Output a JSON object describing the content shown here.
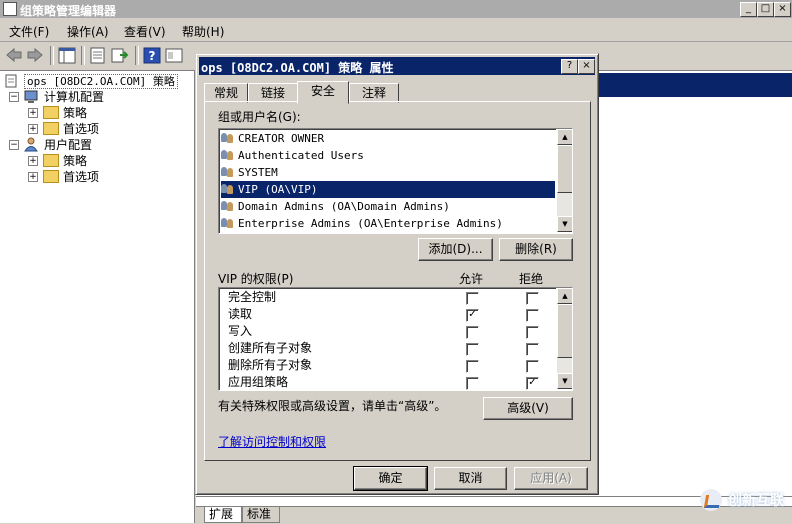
{
  "window": {
    "title": "组策略管理编辑器"
  },
  "menu": [
    "文件(F)",
    "操作(A)",
    "查看(V)",
    "帮助(H)"
  ],
  "tree": {
    "root": "ops [O8DC2.OA.COM] 策略",
    "computer_config": "计算机配置",
    "user_config": "用户配置",
    "policies": "策略",
    "preferences": "首选项"
  },
  "bottom_tabs": [
    "扩展",
    "标准"
  ],
  "dialog": {
    "title": "ops [O8DC2.OA.COM] 策略 属性",
    "tabs": [
      "常规",
      "链接",
      "安全",
      "注释"
    ],
    "active_tab": "安全",
    "groups_label": "组或用户名(G):",
    "users": [
      "CREATOR OWNER",
      "Authenticated Users",
      "SYSTEM",
      "VIP (OA\\VIP)",
      "Domain Admins (OA\\Domain Admins)",
      "Enterprise Admins (OA\\Enterprise Admins)"
    ],
    "selected_user_index": 3,
    "add_button": "添加(D)...",
    "remove_button": "删除(R)",
    "perm_label": "VIP 的权限(P)",
    "allow_header": "允许",
    "deny_header": "拒绝",
    "permissions": [
      {
        "name": "完全控制",
        "allow": false,
        "deny": false
      },
      {
        "name": "读取",
        "allow": true,
        "deny": false
      },
      {
        "name": "写入",
        "allow": false,
        "deny": false
      },
      {
        "name": "创建所有子对象",
        "allow": false,
        "deny": false
      },
      {
        "name": "删除所有子对象",
        "allow": false,
        "deny": false
      },
      {
        "name": "应用组策略",
        "allow": false,
        "deny": true
      }
    ],
    "advanced_note": "有关特殊权限或高级设置，请单击“高级”。",
    "advanced_button": "高级(V)",
    "learn_link": "了解访问控制和权限",
    "ok_button": "确定",
    "cancel_button": "取消",
    "apply_button": "应用(A)"
  },
  "watermark": "创新互联"
}
